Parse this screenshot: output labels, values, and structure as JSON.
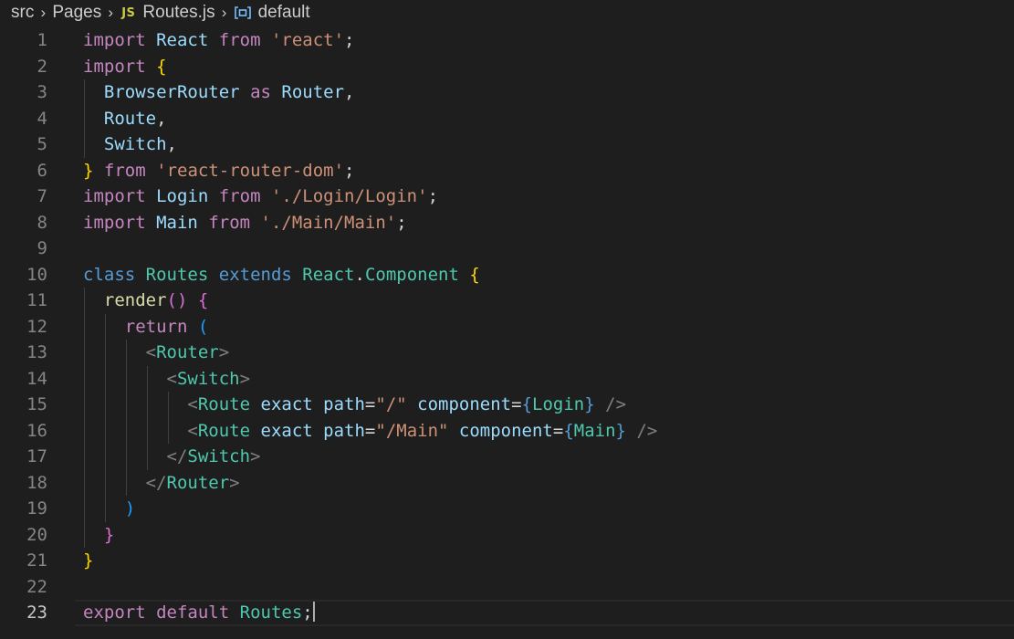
{
  "breadcrumb": {
    "items": [
      "src",
      "Pages",
      "Routes.js",
      "default"
    ],
    "file_icon": "JS",
    "icons": [
      "chevron-right-icon",
      "js-file-icon",
      "symbol-variable-icon"
    ]
  },
  "theme": {
    "background": "#1e1e1e",
    "keyword": "#c586c0",
    "storage": "#569cd6",
    "class": "#4ec9b0",
    "variable": "#9cdcfe",
    "string": "#ce9178",
    "function": "#dcdcaa"
  },
  "editor": {
    "cursor_line": 23,
    "lines": [
      {
        "n": "1",
        "tokens": [
          [
            "import",
            "kw"
          ],
          [
            " ",
            "pun"
          ],
          [
            "React",
            "var"
          ],
          [
            " ",
            "pun"
          ],
          [
            "from",
            "kw"
          ],
          [
            " ",
            "pun"
          ],
          [
            "'react'",
            "str"
          ],
          [
            ";",
            "pun"
          ]
        ]
      },
      {
        "n": "2",
        "tokens": [
          [
            "import",
            "kw"
          ],
          [
            " ",
            "pun"
          ],
          [
            "{",
            "br1"
          ]
        ]
      },
      {
        "n": "3",
        "tokens": [
          [
            "  ",
            "pun"
          ],
          [
            "BrowserRouter",
            "var"
          ],
          [
            " ",
            "pun"
          ],
          [
            "as",
            "kw"
          ],
          [
            " ",
            "pun"
          ],
          [
            "Router",
            "var"
          ],
          [
            ",",
            "pun"
          ]
        ]
      },
      {
        "n": "4",
        "tokens": [
          [
            "  ",
            "pun"
          ],
          [
            "Route",
            "var"
          ],
          [
            ",",
            "pun"
          ]
        ]
      },
      {
        "n": "5",
        "tokens": [
          [
            "  ",
            "pun"
          ],
          [
            "Switch",
            "var"
          ],
          [
            ",",
            "pun"
          ]
        ]
      },
      {
        "n": "6",
        "tokens": [
          [
            "}",
            "br1"
          ],
          [
            " ",
            "pun"
          ],
          [
            "from",
            "kw"
          ],
          [
            " ",
            "pun"
          ],
          [
            "'react-router-dom'",
            "str"
          ],
          [
            ";",
            "pun"
          ]
        ]
      },
      {
        "n": "7",
        "tokens": [
          [
            "import",
            "kw"
          ],
          [
            " ",
            "pun"
          ],
          [
            "Login",
            "var"
          ],
          [
            " ",
            "pun"
          ],
          [
            "from",
            "kw"
          ],
          [
            " ",
            "pun"
          ],
          [
            "'./Login/Login'",
            "str"
          ],
          [
            ";",
            "pun"
          ]
        ]
      },
      {
        "n": "8",
        "tokens": [
          [
            "import",
            "kw"
          ],
          [
            " ",
            "pun"
          ],
          [
            "Main",
            "var"
          ],
          [
            " ",
            "pun"
          ],
          [
            "from",
            "kw"
          ],
          [
            " ",
            "pun"
          ],
          [
            "'./Main/Main'",
            "str"
          ],
          [
            ";",
            "pun"
          ]
        ]
      },
      {
        "n": "9",
        "tokens": []
      },
      {
        "n": "10",
        "tokens": [
          [
            "class",
            "st"
          ],
          [
            " ",
            "pun"
          ],
          [
            "Routes",
            "cls"
          ],
          [
            " ",
            "pun"
          ],
          [
            "extends",
            "st"
          ],
          [
            " ",
            "pun"
          ],
          [
            "React",
            "cls"
          ],
          [
            ".",
            "pun"
          ],
          [
            "Component",
            "cls"
          ],
          [
            " ",
            "pun"
          ],
          [
            "{",
            "br1"
          ]
        ]
      },
      {
        "n": "11",
        "tokens": [
          [
            "  ",
            "pun"
          ],
          [
            "render",
            "fn"
          ],
          [
            "()",
            "br2"
          ],
          [
            " ",
            "pun"
          ],
          [
            "{",
            "br2"
          ]
        ]
      },
      {
        "n": "12",
        "tokens": [
          [
            "    ",
            "pun"
          ],
          [
            "return",
            "kw"
          ],
          [
            " ",
            "pun"
          ],
          [
            "(",
            "br3"
          ]
        ]
      },
      {
        "n": "13",
        "tokens": [
          [
            "      ",
            "pun"
          ],
          [
            "<",
            "ang"
          ],
          [
            "Router",
            "tag"
          ],
          [
            ">",
            "ang"
          ]
        ]
      },
      {
        "n": "14",
        "tokens": [
          [
            "        ",
            "pun"
          ],
          [
            "<",
            "ang"
          ],
          [
            "Switch",
            "tag"
          ],
          [
            ">",
            "ang"
          ]
        ]
      },
      {
        "n": "15",
        "tokens": [
          [
            "          ",
            "pun"
          ],
          [
            "<",
            "ang"
          ],
          [
            "Route",
            "tag"
          ],
          [
            " ",
            "pun"
          ],
          [
            "exact",
            "var"
          ],
          [
            " ",
            "pun"
          ],
          [
            "path",
            "var"
          ],
          [
            "=",
            "pun"
          ],
          [
            "\"/\"",
            "str"
          ],
          [
            " ",
            "pun"
          ],
          [
            "component",
            "var"
          ],
          [
            "=",
            "pun"
          ],
          [
            "{",
            "st"
          ],
          [
            "Login",
            "cls"
          ],
          [
            "}",
            "st"
          ],
          [
            " ",
            "pun"
          ],
          [
            "/>",
            "ang"
          ]
        ]
      },
      {
        "n": "16",
        "tokens": [
          [
            "          ",
            "pun"
          ],
          [
            "<",
            "ang"
          ],
          [
            "Route",
            "tag"
          ],
          [
            " ",
            "pun"
          ],
          [
            "exact",
            "var"
          ],
          [
            " ",
            "pun"
          ],
          [
            "path",
            "var"
          ],
          [
            "=",
            "pun"
          ],
          [
            "\"/Main\"",
            "str"
          ],
          [
            " ",
            "pun"
          ],
          [
            "component",
            "var"
          ],
          [
            "=",
            "pun"
          ],
          [
            "{",
            "st"
          ],
          [
            "Main",
            "cls"
          ],
          [
            "}",
            "st"
          ],
          [
            " ",
            "pun"
          ],
          [
            "/>",
            "ang"
          ]
        ]
      },
      {
        "n": "17",
        "tokens": [
          [
            "        ",
            "pun"
          ],
          [
            "</",
            "ang"
          ],
          [
            "Switch",
            "tag"
          ],
          [
            ">",
            "ang"
          ]
        ]
      },
      {
        "n": "18",
        "tokens": [
          [
            "      ",
            "pun"
          ],
          [
            "</",
            "ang"
          ],
          [
            "Router",
            "tag"
          ],
          [
            ">",
            "ang"
          ]
        ]
      },
      {
        "n": "19",
        "tokens": [
          [
            "    ",
            "pun"
          ],
          [
            ")",
            "br3"
          ]
        ]
      },
      {
        "n": "20",
        "tokens": [
          [
            "  ",
            "pun"
          ],
          [
            "}",
            "br2"
          ]
        ]
      },
      {
        "n": "21",
        "tokens": [
          [
            "}",
            "br1"
          ]
        ]
      },
      {
        "n": "22",
        "tokens": []
      },
      {
        "n": "23",
        "tokens": [
          [
            "export",
            "kw"
          ],
          [
            " ",
            "pun"
          ],
          [
            "default",
            "kw"
          ],
          [
            " ",
            "pun"
          ],
          [
            "Routes",
            "cls"
          ],
          [
            ";",
            "pun"
          ]
        ]
      }
    ]
  }
}
